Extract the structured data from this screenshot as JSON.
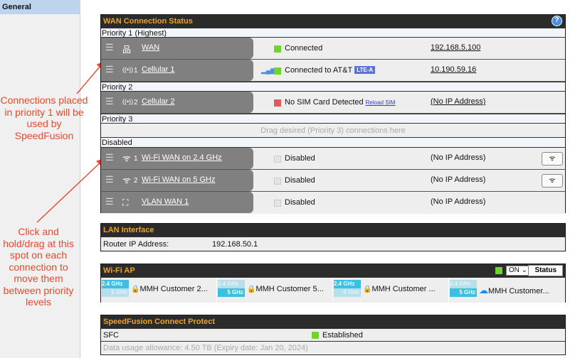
{
  "sidebar": {
    "active_item": "General"
  },
  "annotations": {
    "connections_note": "Connections placed in priority 1 will be used by SpeedFusion",
    "drag_note": "Click and hold/drag at this spot on each connection to move them between priority levels"
  },
  "wan_panel": {
    "title": "WAN Connection Status",
    "help_icon": "help-circle-icon",
    "priority1_label": "Priority 1 (Highest)",
    "priority2_label": "Priority 2",
    "priority3_label": "Priority 3",
    "disabled_label": "Disabled",
    "drag_hint": "Drag desired (Priority 3) connections here",
    "rows": [
      {
        "name": "WAN",
        "icon": "ethernet-icon",
        "index": "",
        "status": "Connected",
        "status_color": "#6fd52c",
        "ip": "192.168.5.100"
      },
      {
        "name": "Cellular 1",
        "icon": "cellular-icon",
        "index": "1",
        "status": "Connected to AT&T",
        "status_color": "#6fd52c",
        "badge": "LTE-A",
        "ip": "10.190.59.16"
      },
      {
        "name": "Cellular 2",
        "icon": "cellular-icon",
        "index": "2",
        "status": "No SIM Card Detected",
        "status_color": "#e05a5a",
        "reload_label": "Reload SIM",
        "ip": "(No IP Address)"
      },
      {
        "name": "Wi-Fi WAN on 2.4 GHz",
        "icon": "wifi-icon",
        "index": "1",
        "status": "Disabled",
        "status_color": "#e4e4e4",
        "ip": "(No IP Address)",
        "action_icon": "wifi-scan-icon"
      },
      {
        "name": "Wi-Fi WAN on 5 GHz",
        "icon": "wifi-icon",
        "index": "2",
        "status": "Disabled",
        "status_color": "#e4e4e4",
        "ip": "(No IP Address)",
        "action_icon": "wifi-scan-icon"
      },
      {
        "name": "VLAN WAN 1",
        "icon": "vlan-icon",
        "index": "",
        "status": "Disabled",
        "status_color": "#e4e4e4",
        "ip": "(No IP Address)"
      }
    ]
  },
  "lan_panel": {
    "title": "LAN Interface",
    "router_ip_label": "Router IP Address:",
    "router_ip": "192.168.50.1"
  },
  "wifi_panel": {
    "title": "Wi-Fi AP",
    "on_value": "ON",
    "status_button": "Status",
    "band_24": "2.4 GHz",
    "band_5": "5 GHz",
    "aps": [
      {
        "name": "MMH Customer 2...",
        "band24_on": true,
        "band5_on": false,
        "icon": "lock-icon"
      },
      {
        "name": "MMH Customer 5...",
        "band24_on": false,
        "band5_on": true,
        "icon": "lock-icon"
      },
      {
        "name": "MMH Customer ...",
        "band24_on": true,
        "band5_on": false,
        "icon": "lock-icon"
      },
      {
        "name": "MMH Customer...",
        "band24_on": false,
        "band5_on": true,
        "icon": "cloud-icon"
      }
    ]
  },
  "sfc_panel": {
    "title": "SpeedFusion Connect Protect",
    "label": "SFC",
    "status": "Established",
    "usage": "Data usage allowance: 4.50 TB (Expiry date: Jan 20, 2024)"
  }
}
